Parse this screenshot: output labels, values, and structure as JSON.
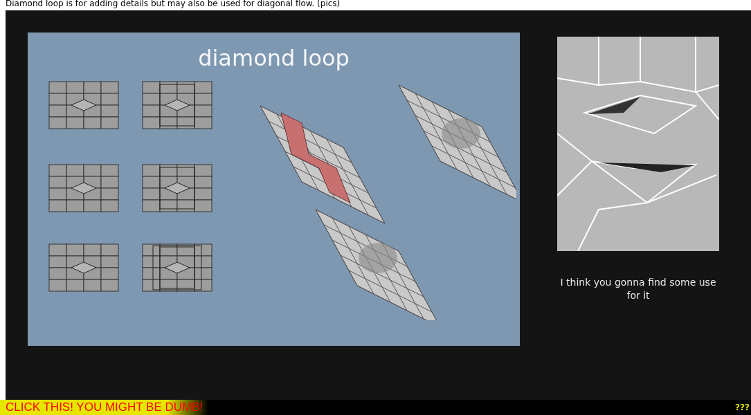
{
  "intro": "Diamond loop is for adding details but may also be used for diagonal flow. (pics)",
  "slide": {
    "title": "diamond loop"
  },
  "caption": "I think you gonna find some use for it",
  "footer": {
    "link": "CLICK THIS! YOU MIGHT BE DUMB!",
    "corner": "???"
  }
}
